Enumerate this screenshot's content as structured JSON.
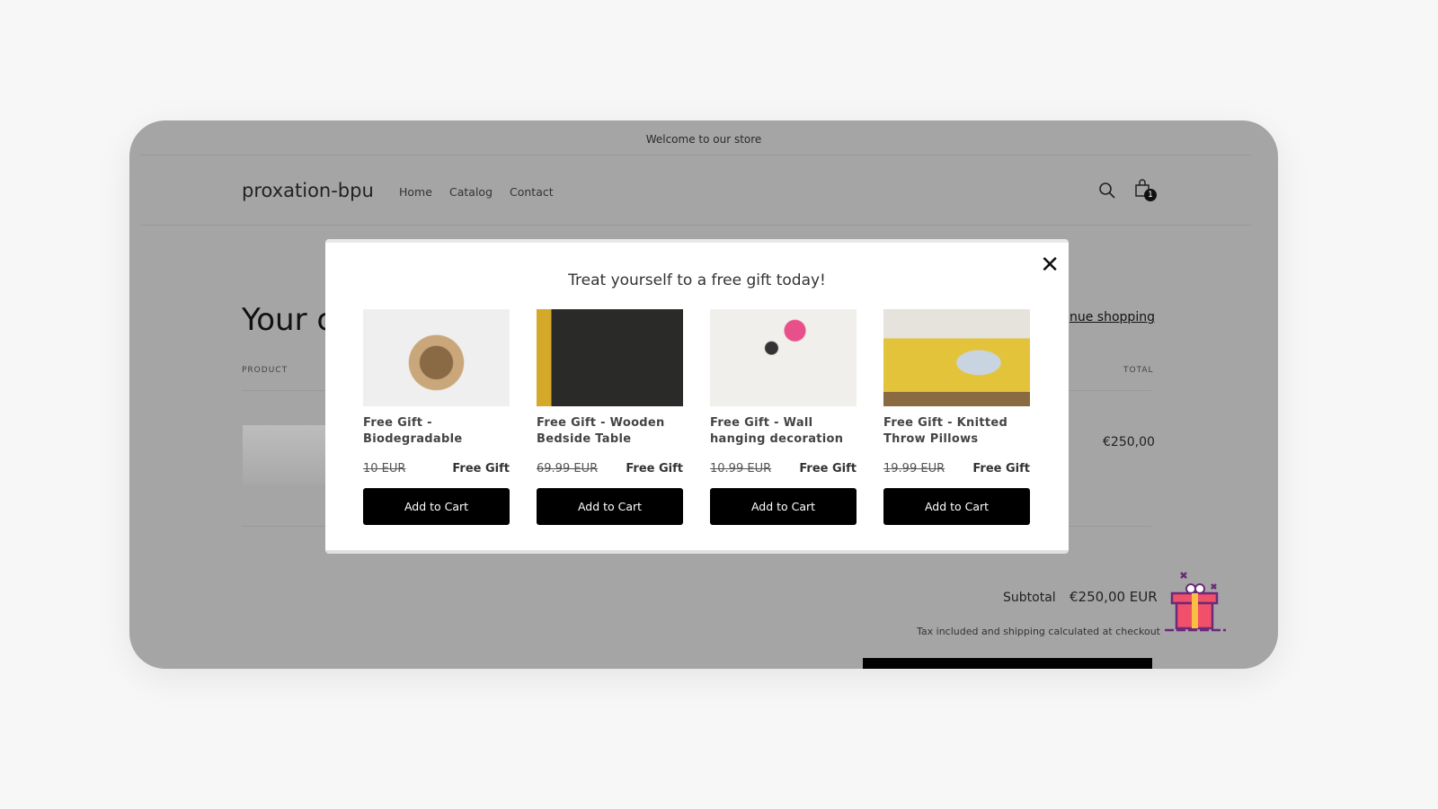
{
  "store": {
    "announcement": "Welcome to our store",
    "logo": "proxation-bpu",
    "nav": [
      "Home",
      "Catalog",
      "Contact"
    ],
    "cart_count": "1",
    "cart_title": "Your c",
    "continue": "nue shopping",
    "col_product": "PRODUCT",
    "col_total": "TOTAL",
    "line_total": "€250,00",
    "subtotal_label": "Subtotal",
    "subtotal_value": "€250,00 EUR",
    "tax_note": "Tax included and shipping calculated at checkout"
  },
  "modal": {
    "title": "Treat yourself to a free gift today!",
    "close_icon": "close-icon",
    "products": [
      {
        "name": "Free Gift - Biodegradable",
        "old_price": "10 EUR",
        "price": "Free Gift",
        "button": "Add to Cart"
      },
      {
        "name": "Free Gift - Wooden Bedside Table",
        "old_price": "69.99 EUR",
        "price": "Free Gift",
        "button": "Add to Cart"
      },
      {
        "name": "Free Gift - Wall hanging decoration",
        "old_price": "10.99 EUR",
        "price": "Free Gift",
        "button": "Add to Cart"
      },
      {
        "name": "Free Gift - Knitted Throw Pillows",
        "old_price": "19.99 EUR",
        "price": "Free Gift",
        "button": "Add to Cart"
      }
    ]
  }
}
